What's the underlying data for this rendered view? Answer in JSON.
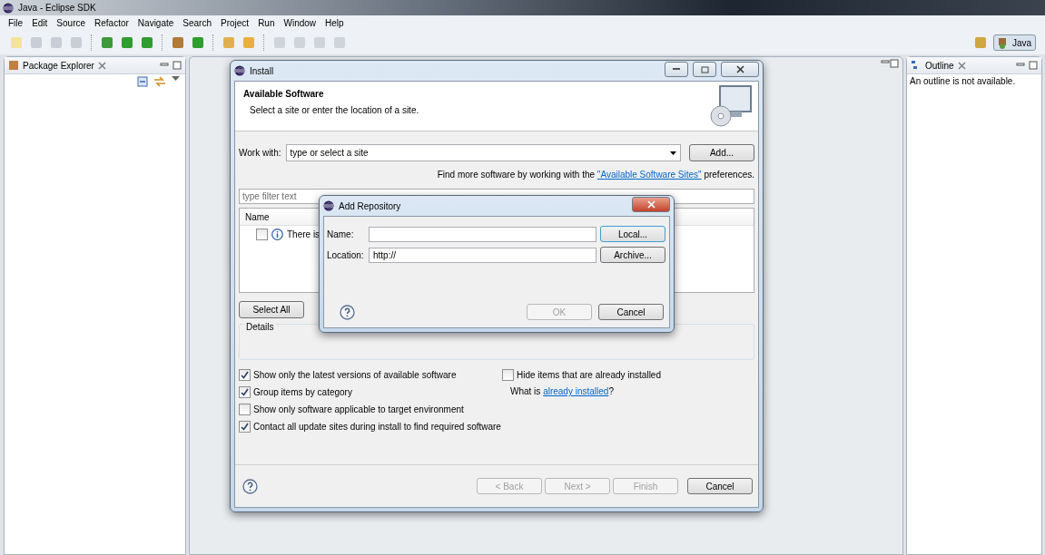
{
  "window": {
    "title": "Java - Eclipse SDK"
  },
  "menu": [
    "File",
    "Edit",
    "Source",
    "Refactor",
    "Navigate",
    "Search",
    "Project",
    "Run",
    "Window",
    "Help"
  ],
  "perspective": {
    "label": "Java",
    "selected": true
  },
  "package_explorer": {
    "title": "Package Explorer"
  },
  "outline": {
    "title": "Outline",
    "message": "An outline is not available."
  },
  "install_dialog": {
    "title": "Install",
    "header_title": "Available Software",
    "header_subtitle": "Select a site or enter the location of a site.",
    "work_with_label": "Work with:",
    "work_with_value": "type or select a site",
    "add_button": "Add...",
    "find_more": {
      "prefix": "Find more software by working with the ",
      "link": "\"Available Software Sites\"",
      "suffix": " preferences."
    },
    "filter_placeholder": "type filter text",
    "table": {
      "columns": [
        "Name"
      ],
      "rows": [
        {
          "text": "There is",
          "checked": false
        }
      ]
    },
    "select_all": "Select All",
    "details_label": "Details",
    "options": [
      {
        "label": "Show only the latest versions of available software",
        "checked": true
      },
      {
        "label": "Group items by category",
        "checked": true
      },
      {
        "label": "Show only software applicable to target environment",
        "checked": false
      },
      {
        "label": "Contact all update sites during install to find required software",
        "checked": true
      }
    ],
    "hide_installed": {
      "label": "Hide items that are already installed",
      "checked": false
    },
    "what_is": {
      "prefix": "What is ",
      "link": "already installed",
      "suffix": "?"
    },
    "buttons": [
      {
        "label": "< Back",
        "disabled": true
      },
      {
        "label": "Next >",
        "disabled": true
      },
      {
        "label": "Finish",
        "disabled": true
      },
      {
        "label": "Cancel",
        "disabled": false
      }
    ]
  },
  "add_repository": {
    "title": "Add Repository",
    "fields": [
      {
        "label": "Name:",
        "button": "Local...",
        "focused": true
      },
      {
        "label": "Location:",
        "value": "http://",
        "button": "Archive...",
        "focused": false
      }
    ],
    "buttons": [
      {
        "label": "OK",
        "disabled": true
      },
      {
        "label": "Cancel",
        "disabled": false
      }
    ]
  }
}
